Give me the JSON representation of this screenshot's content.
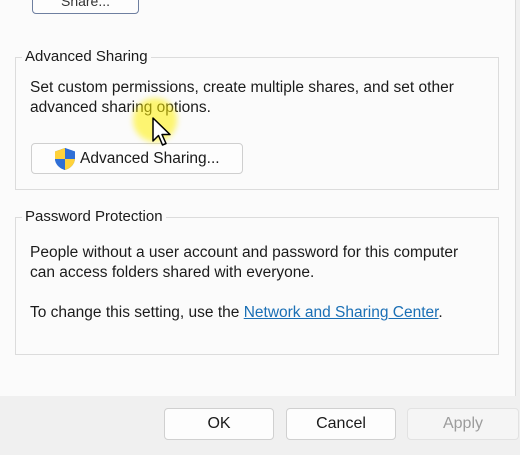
{
  "top": {
    "share_button_label": "Share..."
  },
  "advanced_sharing": {
    "title": "Advanced Sharing",
    "description_line1": "Set custom permissions, create multiple shares, and set other",
    "description_line2": "advanced sharing options.",
    "button_label": "Advanced Sharing...",
    "button_icon": "uac-shield-icon"
  },
  "password_protection": {
    "title": "Password Protection",
    "description_line1": "People without a user account and password for this computer",
    "description_line2": "can access folders shared with everyone.",
    "change_prefix": "To change this setting, use the ",
    "link_label": "Network and Sharing Center",
    "change_suffix": "."
  },
  "footer": {
    "ok_label": "OK",
    "cancel_label": "Cancel",
    "apply_label": "Apply"
  },
  "colors": {
    "link": "#1a6fb5",
    "cursor_highlight": "#fff000"
  }
}
